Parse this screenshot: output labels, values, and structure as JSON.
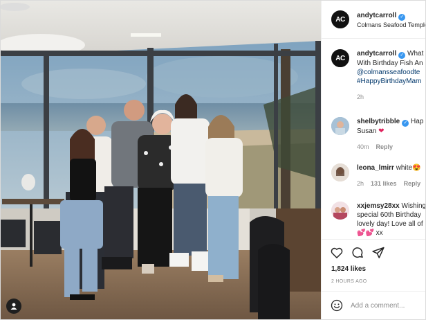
{
  "post": {
    "username": "andytcarroll",
    "location": "Colmans Seafood Temple",
    "avatar_initials": "AC"
  },
  "caption": {
    "username": "andytcarroll",
    "text": "What",
    "line2": "With Birthday Fish An",
    "mention": "@colmansseafoodte",
    "hashtag": "#HappyBirthdayMam",
    "time": "2h"
  },
  "comments": [
    {
      "username": "shelbytribble",
      "text": "Hap",
      "line2": "Susan",
      "emoji": "❤",
      "time": "40m",
      "reply": "Reply"
    },
    {
      "username": "leona_lmirr",
      "text": "white",
      "emoji": "😍",
      "time": "2h",
      "likes": "131 likes",
      "reply": "Reply"
    },
    {
      "username": "xxjemsy28xx",
      "text": "Wishing",
      "line2": "special 60th Birthday",
      "line3": "lovely day! Love all of",
      "line4": "💕💕 xx"
    }
  ],
  "footer": {
    "likes": "1,824 likes",
    "ago": "2 HOURS AGO",
    "add_comment_placeholder": "Add a comment..."
  },
  "icons": {
    "like": "heart-icon",
    "comment": "comment-bubble-icon",
    "share": "paper-plane-icon",
    "emoji": "smiley-icon",
    "tag": "user-tag-icon"
  },
  "colors": {
    "verified": "#3897f0",
    "link": "#00376b",
    "muted": "#8e8e8e"
  }
}
